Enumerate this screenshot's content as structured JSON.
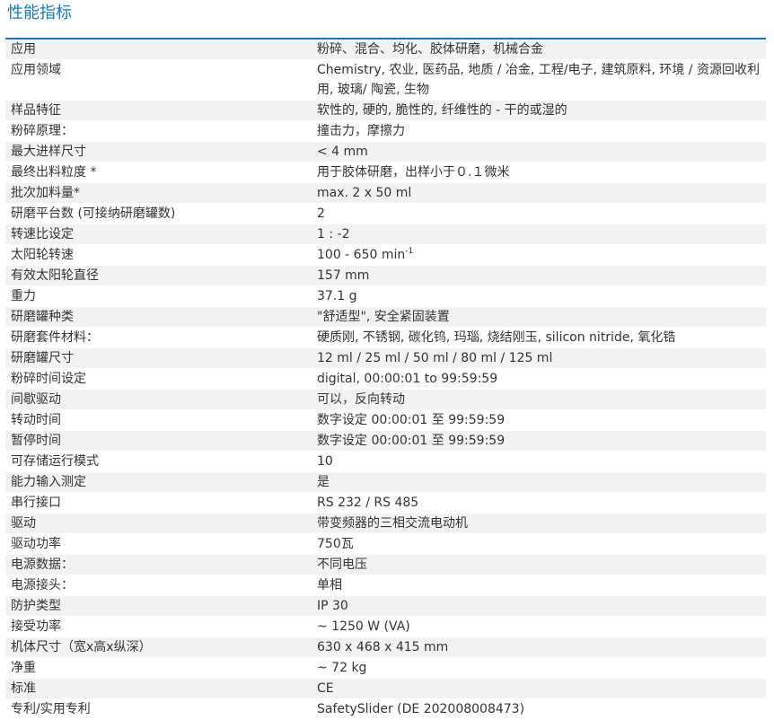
{
  "title": "性能指标",
  "rows": [
    {
      "label": "应用",
      "value": "粉碎、混合、均化、胶体研磨，机械合金"
    },
    {
      "label": "应用领域",
      "value": "Chemistry, 农业, 医药品, 地质 / 冶金, 工程/电子, 建筑原料, 环境 / 资源回收利用, 玻璃/ 陶瓷, 生物"
    },
    {
      "label": "样品特征",
      "value": "软性的, 硬的, 脆性的, 纤维性的 - 干的或湿的"
    },
    {
      "label": "粉碎原理：",
      "value": "撞击力，摩擦力"
    },
    {
      "label": "最大进样尺寸",
      "value": "< 4 mm"
    },
    {
      "label": "最终出料粒度 *",
      "value": "用于胶体研磨，出样小于０.１微米"
    },
    {
      "label": "批次加料量*",
      "value": "max. 2 x 50 ml"
    },
    {
      "label": "研磨平台数 (可接纳研磨罐数)",
      "value": "2"
    },
    {
      "label": "转速比设定",
      "value": "1 : -2"
    },
    {
      "label": "太阳轮转速",
      "value": "100 - 650 min",
      "sup": "-1"
    },
    {
      "label": "有效太阳轮直径",
      "value": "157 mm"
    },
    {
      "label": "重力",
      "value": "37.1 g"
    },
    {
      "label": "研磨罐种类",
      "value": "\"舒适型\", 安全紧固装置"
    },
    {
      "label": "研磨套件材料：",
      "value": "硬质刚, 不锈钢, 碳化钨, 玛瑙, 烧结刚玉, silicon nitride, 氧化锆"
    },
    {
      "label": "研磨罐尺寸",
      "value": "12 ml / 25 ml / 50 ml / 80 ml / 125 ml"
    },
    {
      "label": "粉碎时间设定",
      "value": "digital, 00:00:01 to 99:59:59"
    },
    {
      "label": "间歇驱动",
      "value": "可以，反向转动"
    },
    {
      "label": "转动时间",
      "value": "数字设定 00:00:01 至 99:59:59"
    },
    {
      "label": "暂停时间",
      "value": "数字设定 00:00:01 至 99:59:59"
    },
    {
      "label": "可存储运行模式",
      "value": "10"
    },
    {
      "label": "能力输入测定",
      "value": "是"
    },
    {
      "label": "串行接口",
      "value": "RS 232 / RS 485"
    },
    {
      "label": "驱动",
      "value": "带变频器的三相交流电动机"
    },
    {
      "label": "驱动功率",
      "value": "750瓦"
    },
    {
      "label": "电源数据：",
      "value": "不同电压"
    },
    {
      "label": "电源接头：",
      "value": "单相"
    },
    {
      "label": "防护类型",
      "value": "IP 30"
    },
    {
      "label": "接受功率",
      "value": "~ 1250 W (VA)"
    },
    {
      "label": "机体尺寸（宽x高x纵深）",
      "value": "630 x 468 x 415 mm"
    },
    {
      "label": "净重",
      "value": "~ 72 kg"
    },
    {
      "label": "标准",
      "value": "CE"
    },
    {
      "label": "专利/实用专利",
      "value": "SafetySlider (DE 202008008473)"
    }
  ]
}
